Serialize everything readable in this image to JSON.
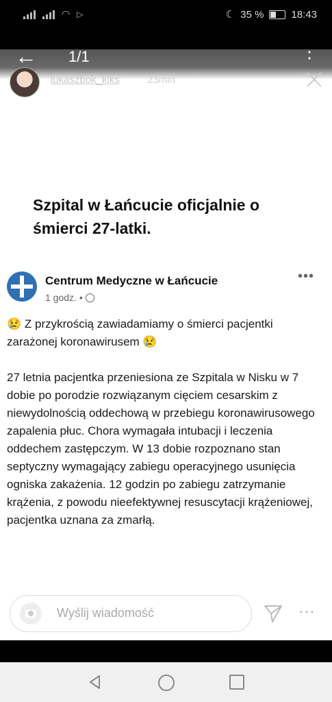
{
  "status_bar": {
    "battery_percent": "35 %",
    "time": "18:43"
  },
  "story_header": {
    "count": "1/1",
    "username": "lukaszbok_kiks",
    "time_ago": "23min"
  },
  "headline": "Szpital w Łańcucie oficjalnie o śmierci 27-latki.",
  "post": {
    "org_name": "Centrum Medyczne w Łańcucie",
    "meta": "1 godz. •",
    "paragraph1": "😢 Z przykrością zawiadamiamy o śmierci pacjentki zarażonej koronawirusem 😢",
    "paragraph2": "27 letnia pacjentka przeniesiona ze Szpitala w Nisku w 7 dobie po porodzie rozwiązanym cięciem cesarskim z niewydolnością  oddechową w przebiegu koronawirusowego zapalenia płuc. Chora wymagała intubacji i leczenia oddechem zastępczym. W 13 dobie rozpoznano stan septyczny wymagający zabiegu operacyjnego usunięcia ogniska zakażenia. 12 godzin po zabiegu zatrzymanie krążenia, z powodu nieefektywnej resuscytacji krążeniowej, pacjentka uznana za zmarłą."
  },
  "reply": {
    "placeholder": "Wyślij wiadomość"
  },
  "colors": {
    "accent": "#2f6fb4"
  }
}
